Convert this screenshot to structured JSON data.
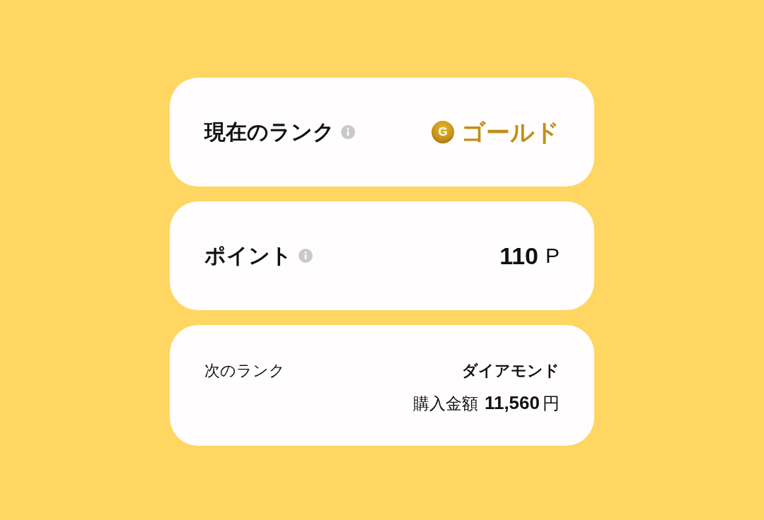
{
  "cards": [
    {
      "kind": "rank",
      "label": "現在のランク",
      "info": true,
      "badge": "G",
      "value": "ゴールド"
    },
    {
      "kind": "points",
      "label": "ポイント",
      "info": true,
      "value": "110",
      "unit": "P"
    },
    {
      "kind": "next",
      "label": "次のランク",
      "next_rank": "ダイアモンド",
      "amount_label": "購入金額",
      "amount": "11,560",
      "unit": "円"
    }
  ]
}
